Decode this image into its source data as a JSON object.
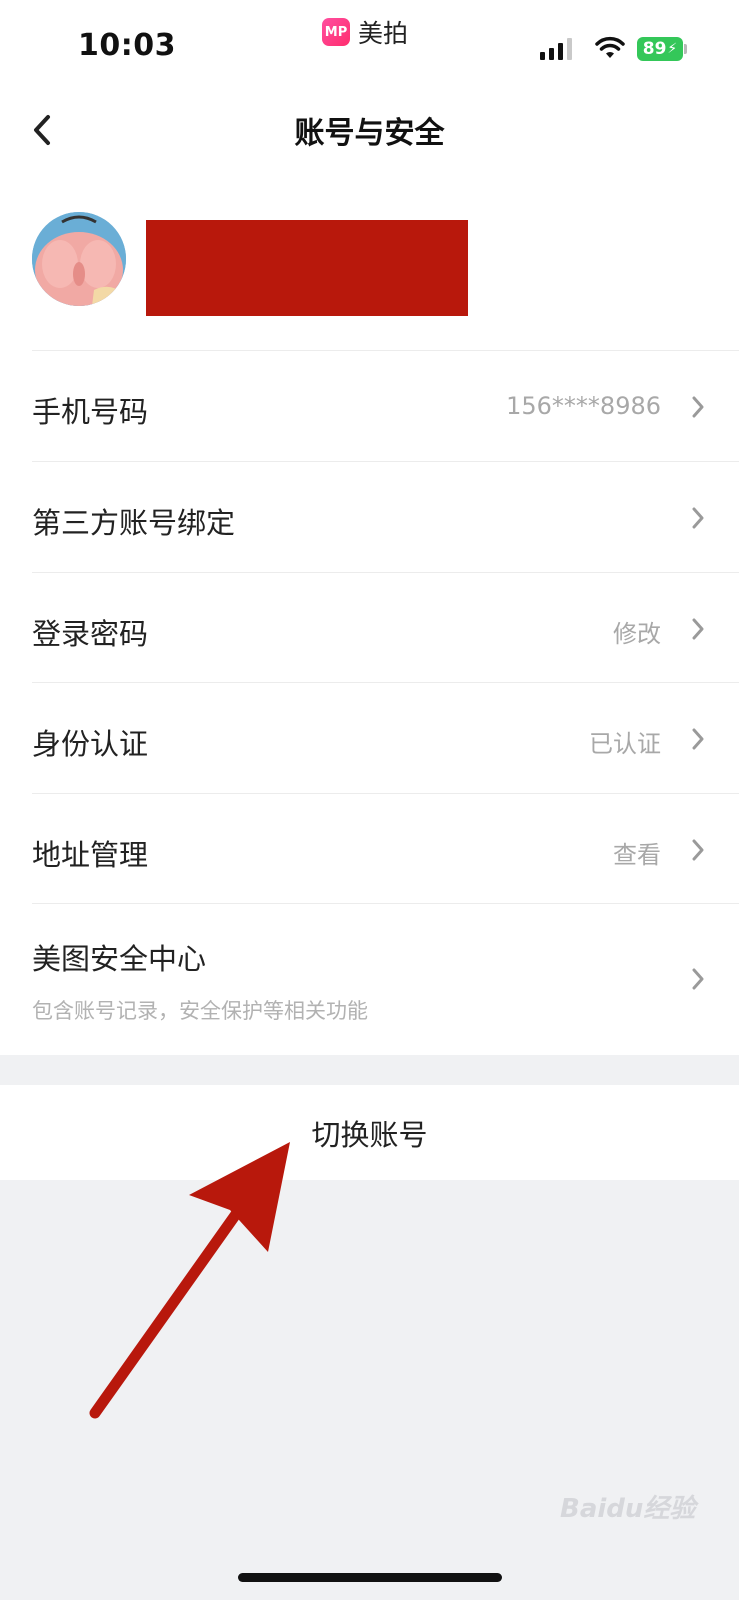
{
  "status_bar": {
    "time": "10:03",
    "app_name": "美拍",
    "app_logo": "MP",
    "battery": "89"
  },
  "nav": {
    "title": "账号与安全",
    "back_icon": "chevron-left-icon"
  },
  "rows": [
    {
      "label": "手机号码",
      "value": "156****8986"
    },
    {
      "label": "第三方账号绑定",
      "value": ""
    },
    {
      "label": "登录密码",
      "value": "修改"
    },
    {
      "label": "身份认证",
      "value": "已认证"
    },
    {
      "label": "地址管理",
      "value": "查看"
    },
    {
      "label": "美图安全中心",
      "sub": "包含账号记录，安全保护等相关功能"
    }
  ],
  "switch_account": "切换账号",
  "watermark": "Baidu经验",
  "colors": {
    "accent_red": "#b8180c",
    "battery_green": "#34c759",
    "background": "#f0f1f3"
  }
}
